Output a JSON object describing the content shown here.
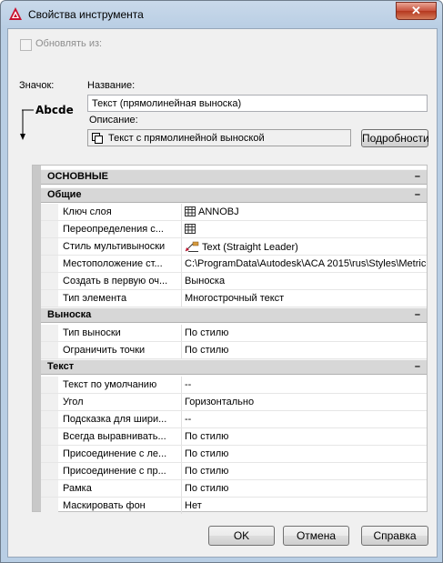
{
  "window": {
    "title": "Свойства инструмента",
    "close_glyph": "✕"
  },
  "update_from": {
    "label": "Обновлять из:",
    "checked": false
  },
  "icon_label": "Значок:",
  "name": {
    "label": "Название:",
    "value": "Текст (прямолинейная выноска)"
  },
  "description": {
    "label": "Описание:",
    "value": "Текст с прямолинейной выноской",
    "details_button": "Подробности"
  },
  "preview": {
    "text": "Abcde"
  },
  "grid": {
    "main_header": "ОСНОВНЫЕ",
    "sections": [
      {
        "title": "Общие",
        "rows": [
          {
            "name": "Ключ слоя",
            "value": "ANNOBJ",
            "icon": "table-icon"
          },
          {
            "name": "Переопределения  с...",
            "value": "",
            "icon": "table-icon"
          },
          {
            "name": "Стиль мультивыноски",
            "value": "Text (Straight Leader)",
            "icon": "leader-style-icon"
          },
          {
            "name": "Местоположение  ст...",
            "value": "C:\\ProgramData\\Autodesk\\ACA 2015\\rus\\Styles\\Metric...",
            "icon": ""
          },
          {
            "name": "Создать в первую оч...",
            "value": "Выноска",
            "icon": ""
          },
          {
            "name": "Тип элемента",
            "value": "Многострочный текст",
            "icon": ""
          }
        ]
      },
      {
        "title": "Выноска",
        "rows": [
          {
            "name": "Тип выноски",
            "value": "По стилю",
            "icon": ""
          },
          {
            "name": "Ограничить точки",
            "value": "По стилю",
            "icon": ""
          }
        ]
      },
      {
        "title": "Текст",
        "rows": [
          {
            "name": "Текст по умолчанию",
            "value": "--",
            "icon": ""
          },
          {
            "name": "Угол",
            "value": "Горизонтально",
            "icon": ""
          },
          {
            "name": "Подсказка для шири...",
            "value": "--",
            "icon": ""
          },
          {
            "name": "Всегда выравнивать...",
            "value": "По стилю",
            "icon": ""
          },
          {
            "name": "Присоединение с ле...",
            "value": "По стилю",
            "icon": ""
          },
          {
            "name": "Присоединение с пр...",
            "value": "По стилю",
            "icon": ""
          },
          {
            "name": "Рамка",
            "value": "По стилю",
            "icon": ""
          },
          {
            "name": "Маскировать фон",
            "value": "Нет",
            "icon": ""
          }
        ]
      }
    ],
    "collapse_glyph": "–"
  },
  "buttons": {
    "ok": "OK",
    "cancel": "Отмена",
    "help": "Справка"
  },
  "colors": {
    "accent_red": "#c8102e",
    "chrome_blue": "#b9cee4"
  }
}
